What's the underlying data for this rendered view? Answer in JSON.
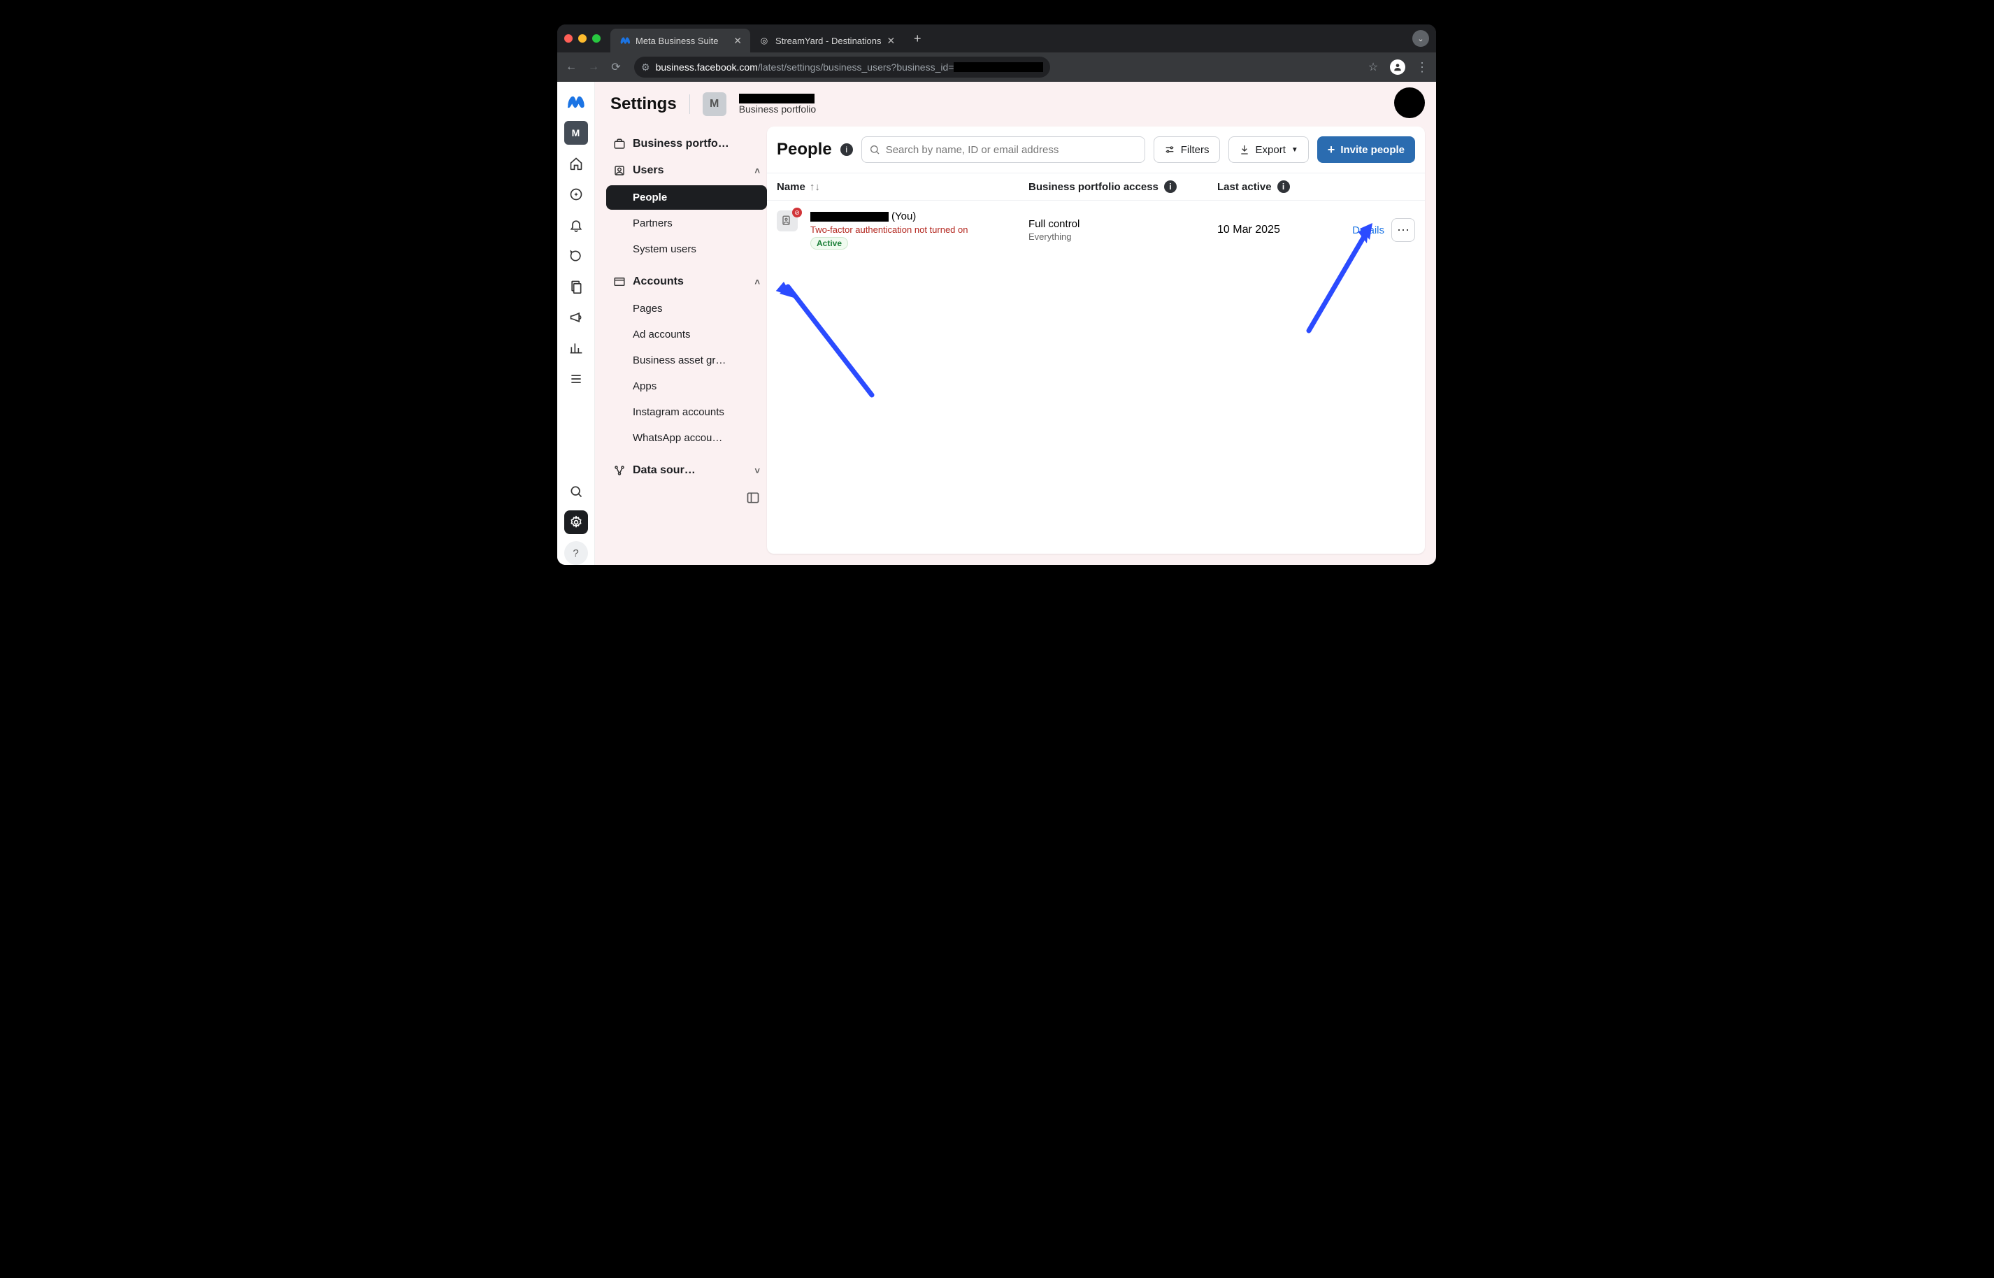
{
  "browser": {
    "tabs": [
      {
        "title": "Meta Business Suite",
        "active": true
      },
      {
        "title": "StreamYard - Destinations",
        "active": false
      }
    ],
    "url_host": "business.facebook.com",
    "url_path": "/latest/settings/business_users?business_id="
  },
  "header": {
    "title": "Settings",
    "chip_letter": "M",
    "portfolio_label": "Business portfolio"
  },
  "rail": {
    "badge": "M"
  },
  "sidebar": {
    "portfolio": "Business portfo…",
    "users": {
      "label": "Users",
      "items": [
        "People",
        "Partners",
        "System users"
      ],
      "selected": 0
    },
    "accounts": {
      "label": "Accounts",
      "items": [
        "Pages",
        "Ad accounts",
        "Business asset gr…",
        "Apps",
        "Instagram accounts",
        "WhatsApp accou…"
      ]
    },
    "datasources": {
      "label": "Data sour…"
    }
  },
  "panel": {
    "title": "People",
    "search_placeholder": "Search by name, ID or email address",
    "filters": "Filters",
    "export": "Export",
    "invite": "Invite people",
    "columns": {
      "name": "Name",
      "access": "Business portfolio access",
      "active": "Last active"
    },
    "row": {
      "you_suffix": "(You)",
      "tfa": "Two-factor authentication not turned on",
      "status": "Active",
      "access": "Full control",
      "access_sub": "Everything",
      "last_active": "10 Mar 2025",
      "details": "Details"
    }
  }
}
